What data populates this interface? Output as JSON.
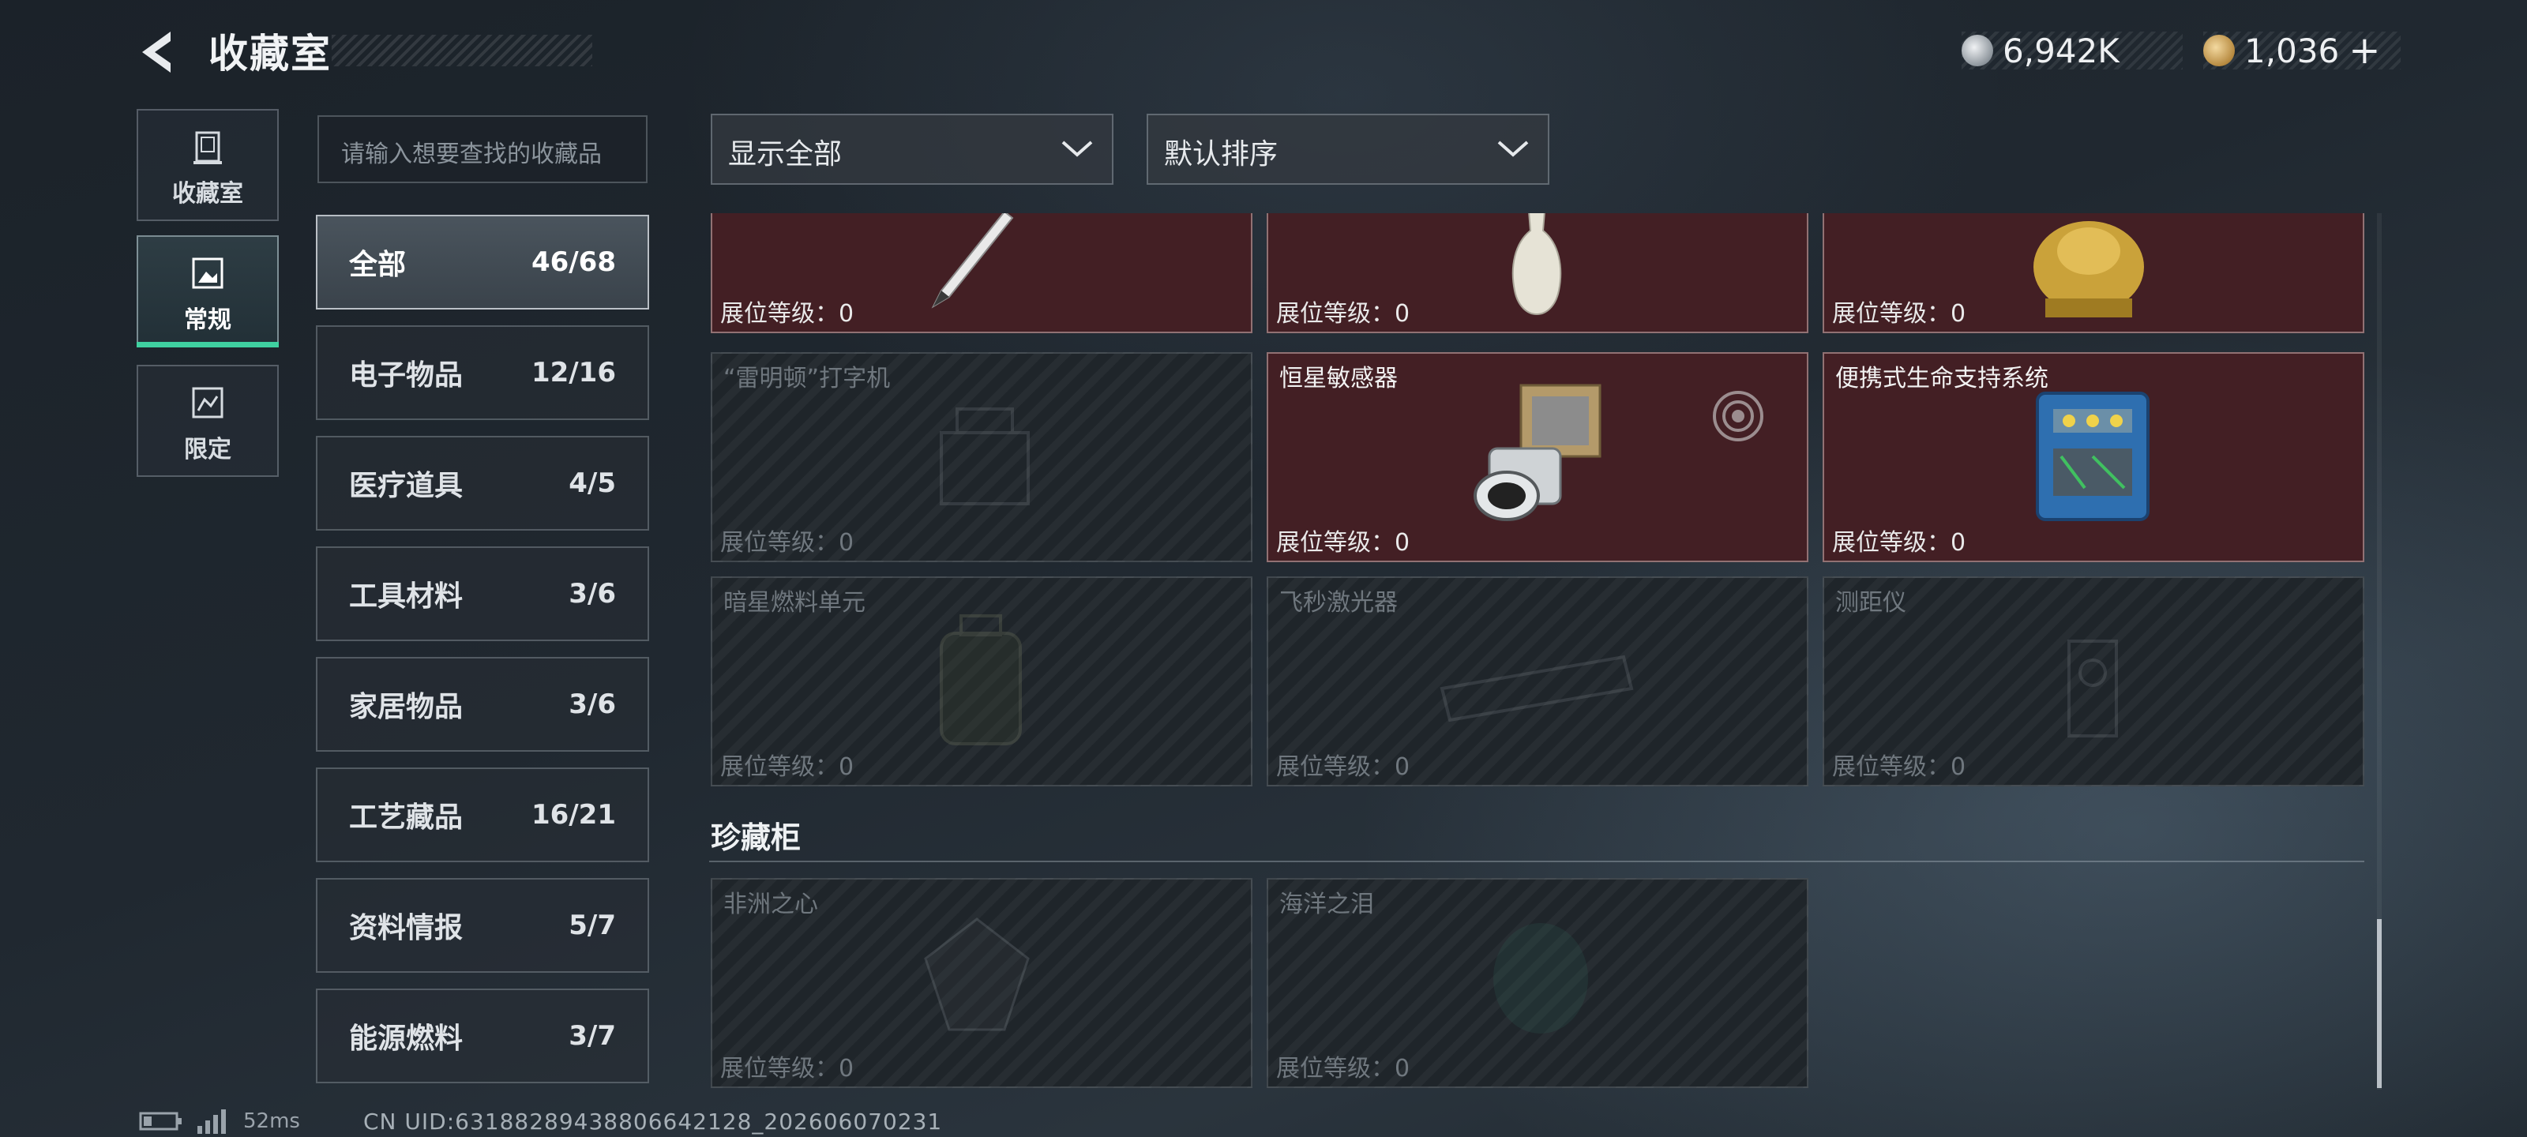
{
  "header": {
    "title": "收藏室",
    "currency": [
      {
        "value": "6,942K",
        "color": "#c7ccd1",
        "icon": "silver-coin-icon"
      },
      {
        "value": "1,036",
        "plus": "+",
        "color": "#c9a05a",
        "icon": "gold-coin-icon"
      }
    ]
  },
  "nav": [
    {
      "label": "收藏室",
      "icon": "trophy-cabinet-icon",
      "active": false
    },
    {
      "label": "常规",
      "icon": "image-frame-icon",
      "active": true
    },
    {
      "label": "限定",
      "icon": "limited-frame-icon",
      "active": false
    }
  ],
  "search": {
    "placeholder": "请输入想要查找的收藏品"
  },
  "filters": {
    "display": "显示全部",
    "sort": "默认排序"
  },
  "categories": [
    {
      "name": "全部",
      "count": "46/68",
      "active": true
    },
    {
      "name": "电子物品",
      "count": "12/16"
    },
    {
      "name": "医疗道具",
      "count": "4/5"
    },
    {
      "name": "工具材料",
      "count": "3/6"
    },
    {
      "name": "家居物品",
      "count": "3/6"
    },
    {
      "name": "工艺藏品",
      "count": "16/21"
    },
    {
      "name": "资料情报",
      "count": "5/7"
    },
    {
      "name": "能源燃料",
      "count": "3/7"
    }
  ],
  "items": [
    {
      "name": "",
      "level": "展位等级：0",
      "owned": true,
      "icon": "fountain-pen-icon"
    },
    {
      "name": "",
      "level": "展位等级：0",
      "owned": true,
      "icon": "porcelain-vase-icon"
    },
    {
      "name": "",
      "level": "展位等级：0",
      "owned": true,
      "icon": "golden-statue-icon"
    },
    {
      "name": "“雷明顿”打字机",
      "level": "展位等级：0",
      "owned": false,
      "icon": "typewriter-icon"
    },
    {
      "name": "恒星敏感器",
      "level": "展位等级：0",
      "owned": true,
      "icon": "star-sensor-icon"
    },
    {
      "name": "便携式生命支持系统",
      "level": "展位等级：0",
      "owned": true,
      "icon": "life-support-icon"
    },
    {
      "name": "暗星燃料单元",
      "level": "展位等级：0",
      "owned": false,
      "icon": "fuel-cell-icon"
    },
    {
      "name": "飞秒激光器",
      "level": "展位等级：0",
      "owned": false,
      "icon": "laser-icon"
    },
    {
      "name": "测距仪",
      "level": "展位等级：0",
      "owned": false,
      "icon": "rangefinder-icon"
    }
  ],
  "treasure": {
    "title": "珍藏柜",
    "items": [
      {
        "name": "非洲之心",
        "level": "展位等级：0",
        "owned": false,
        "icon": "diamond-icon"
      },
      {
        "name": "海洋之泪",
        "level": "展位等级：0",
        "owned": false,
        "icon": "gem-icon"
      }
    ]
  },
  "footer": {
    "ping": "52ms",
    "uid": "CN UID:6318828943880664212​8_202606070231"
  }
}
